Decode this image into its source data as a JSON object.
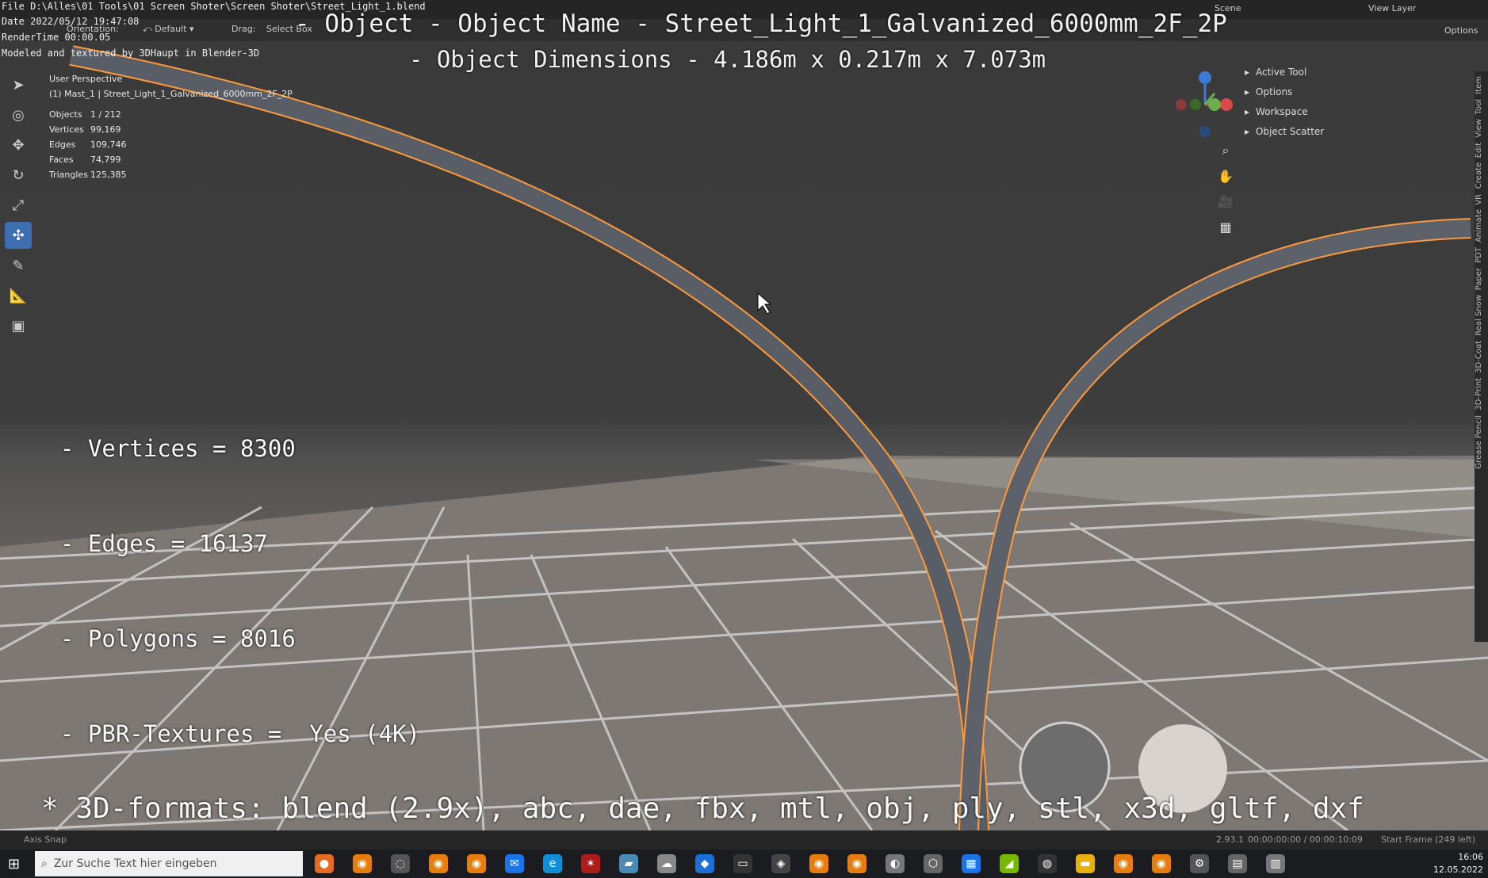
{
  "file_path": "File D:\\Alles\\01 Tools\\01 Screen Shoter\\Screen Shoter\\Street_Light_1.blend",
  "date_line": "Date 2022/05/12 19:47:08",
  "render_line": "RenderTime 00:00.05",
  "model_line": "Modeled and textured by 3DHaupt in Blender-3D",
  "overlay_title": "- Object - Object Name - Street_Light_1_Galvanized_6000mm_2F_2P",
  "overlay_dimensions": "- Object Dimensions -  4.186m x 0.217m x 7.073m",
  "header": {
    "orientation": "Orientation:",
    "default": "Default",
    "drag": "Drag:",
    "select_box": "Select Box",
    "scene": "Scene",
    "view_layer": "View Layer",
    "options": "Options"
  },
  "viewport_info": {
    "perspective": "User Perspective",
    "object_name": "(1) Mast_1 | Street_Light_1_Galvanized_6000mm_2F_2P"
  },
  "stats": [
    {
      "label": "Objects",
      "value": "1 / 212"
    },
    {
      "label": "Vertices",
      "value": "99,169"
    },
    {
      "label": "Edges",
      "value": "109,746"
    },
    {
      "label": "Faces",
      "value": "74,799"
    },
    {
      "label": "Triangles",
      "value": "125,385"
    }
  ],
  "overlay_stats": [
    "- Vertices = 8300",
    "- Edges = 16137",
    "- Polygons = 8016",
    "- PBR-Textures =  Yes (4K)"
  ],
  "overlay_formats": "* 3D-formats: blend (2.9x), abc, dae, fbx, mtl, obj, ply, stl, x3d, gltf, dxf",
  "npanel": {
    "items": [
      "Active Tool",
      "Options",
      "Workspace",
      "Object Scatter"
    ],
    "tabs": [
      "Item",
      "Tool",
      "View",
      "Edit",
      "Create",
      "VR",
      "Animate",
      "PDT",
      "Paper",
      "Real Snow",
      "3D-Coat",
      "3D-Print",
      "Grease Pencil"
    ]
  },
  "gizmo": {
    "z": "Z",
    "y": "Y",
    "x": "X"
  },
  "status": {
    "axis_snap": "Axis Snap",
    "version": "2.93.1",
    "time": "00:00:00:00 / 00:00:10:09",
    "start_frame": "Start Frame (249 left)"
  },
  "taskbar": {
    "search_placeholder": "Zur Suche Text hier eingeben",
    "clock_time": "16:06",
    "clock_date": "12.05.2022"
  },
  "colors": {
    "accent": "#3d6fb0",
    "selection_outline": "#ff9a3c"
  }
}
